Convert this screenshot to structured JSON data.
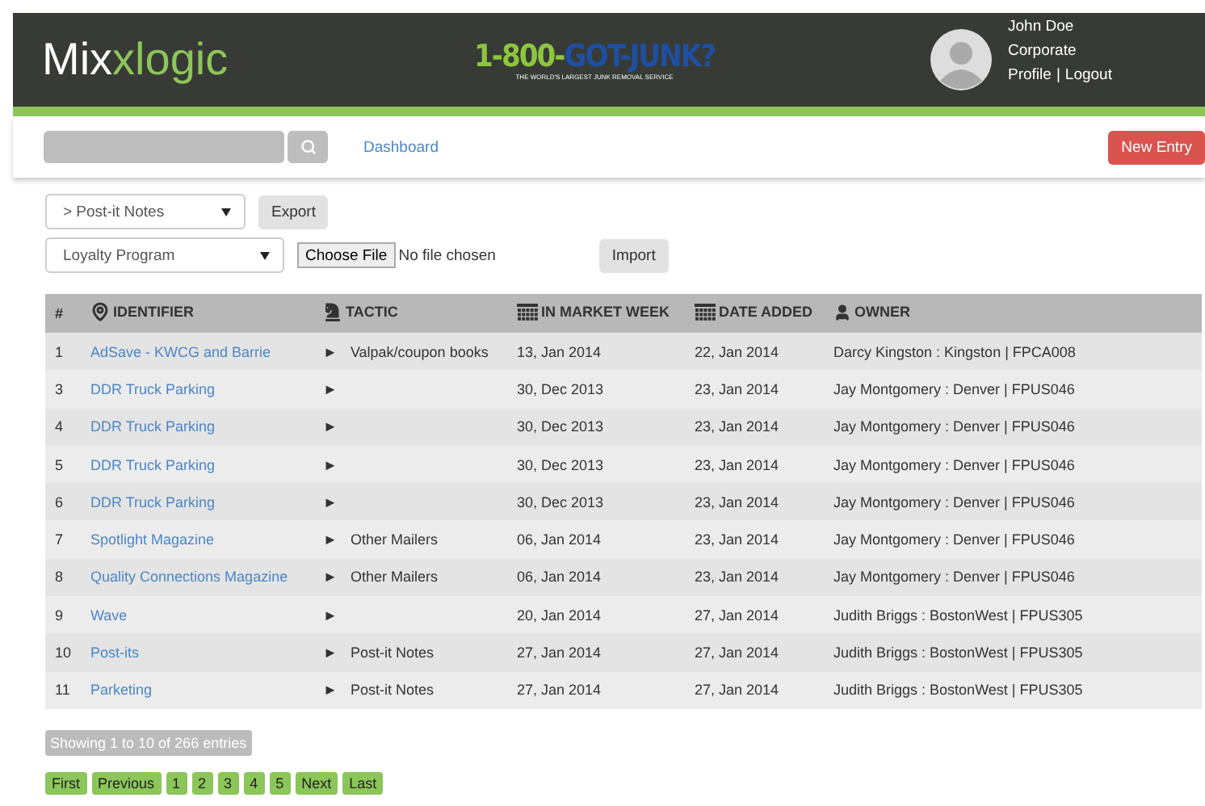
{
  "header": {
    "logo": {
      "part_1": "Mix",
      "part_2": "x",
      "part_3": "logic"
    },
    "client_logo": {
      "number": "1-800-",
      "name": "GOT-JUNK?",
      "tagline": "THE WORLD'S LARGEST JUNK REMOVAL SERVICE"
    },
    "user": {
      "name": "John Doe",
      "role": "Corporate",
      "profile_link": "Profile",
      "separator": "|",
      "logout_link": "Logout"
    }
  },
  "toolbar": {
    "nav_link": "Dashboard",
    "new_button": "New Entry"
  },
  "controls": {
    "export_select": "> Post-it Notes",
    "export_button": "Export",
    "program_select": "Loyalty Program",
    "file_button": "Choose File",
    "file_status": "No file chosen",
    "import_button": "Import"
  },
  "table": {
    "columns": [
      {
        "label": "#",
        "kind": "plain"
      },
      {
        "label": "IDENTIFIER",
        "kind": "location"
      },
      {
        "label": "TACTIC",
        "kind": "strategy"
      },
      {
        "label": "IN MARKET WEEK",
        "kind": "date"
      },
      {
        "label": "DATE ADDED",
        "kind": "date"
      },
      {
        "label": "OWNER",
        "kind": "person"
      }
    ],
    "rows": [
      {
        "num": "1",
        "identifier": "AdSave - KWCG and Barrie",
        "arrow": "►",
        "tactic": "Valpak/coupon books",
        "market_week": "13, Jan 2014",
        "date_added": "22, Jan 2014",
        "owner": "Darcy Kingston : Kingston | FPCA008"
      },
      {
        "num": "3",
        "identifier": "DDR Truck Parking",
        "arrow": "►",
        "tactic": "",
        "market_week": "30, Dec 2013",
        "date_added": "23, Jan 2014",
        "owner": "Jay Montgomery : Denver | FPUS046"
      },
      {
        "num": "4",
        "identifier": "DDR Truck Parking",
        "arrow": "►",
        "tactic": "",
        "market_week": "30, Dec 2013",
        "date_added": "23, Jan 2014",
        "owner": "Jay Montgomery : Denver | FPUS046"
      },
      {
        "num": "5",
        "identifier": "DDR Truck Parking",
        "arrow": "►",
        "tactic": "",
        "market_week": "30, Dec 2013",
        "date_added": "23, Jan 2014",
        "owner": "Jay Montgomery : Denver | FPUS046"
      },
      {
        "num": "6",
        "identifier": "DDR Truck Parking",
        "arrow": "►",
        "tactic": "",
        "market_week": "30, Dec 2013",
        "date_added": "23, Jan 2014",
        "owner": "Jay Montgomery : Denver | FPUS046"
      },
      {
        "num": "7",
        "identifier": "Spotlight Magazine",
        "arrow": "►",
        "tactic": "Other Mailers",
        "market_week": "06, Jan 2014",
        "date_added": "23, Jan 2014",
        "owner": "Jay Montgomery : Denver | FPUS046"
      },
      {
        "num": "8",
        "identifier": "Quality Connections Magazine",
        "arrow": "►",
        "tactic": "Other Mailers",
        "market_week": "06, Jan 2014",
        "date_added": "23, Jan 2014",
        "owner": "Jay Montgomery : Denver | FPUS046"
      },
      {
        "num": "9",
        "identifier": "Wave",
        "arrow": "►",
        "tactic": "",
        "market_week": "20, Jan 2014",
        "date_added": "27, Jan 2014",
        "owner": "Judith Briggs : BostonWest | FPUS305"
      },
      {
        "num": "10",
        "identifier": "Post-its",
        "arrow": "►",
        "tactic": "Post-it Notes",
        "market_week": "27, Jan 2014",
        "date_added": "27, Jan 2014",
        "owner": "Judith Briggs : BostonWest | FPUS305"
      },
      {
        "num": "11",
        "identifier": "Parketing",
        "arrow": "►",
        "tactic": "Post-it Notes",
        "market_week": "27, Jan 2014",
        "date_added": "27, Jan 2014",
        "owner": "Judith Briggs : BostonWest | FPUS305"
      }
    ]
  },
  "info": "Showing 1 to 10 of 266 entries",
  "pagination": [
    "First",
    "Previous",
    "1",
    "2",
    "3",
    "4",
    "5",
    "Next",
    "Last"
  ]
}
